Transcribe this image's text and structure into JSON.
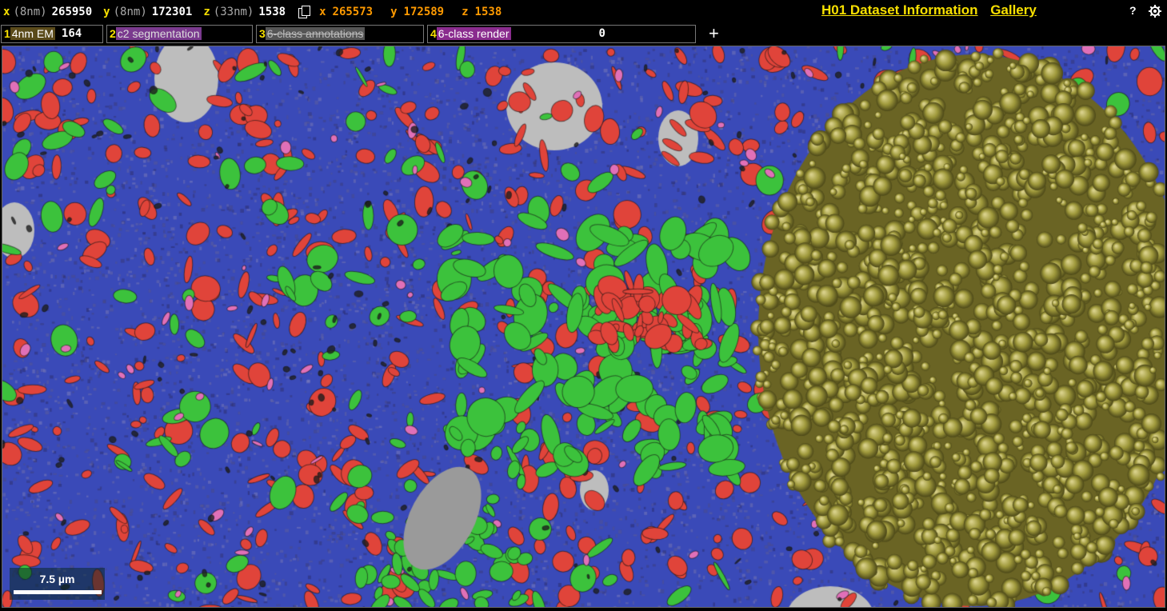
{
  "position": {
    "x": {
      "axis": "x",
      "unit": "(8nm)",
      "value": "265950"
    },
    "y": {
      "axis": "y",
      "unit": "(8nm)",
      "value": "172301"
    },
    "z": {
      "axis": "z",
      "unit": "(33nm)",
      "value": "1538"
    }
  },
  "mouse_position": {
    "x": "265573",
    "y": "172589",
    "z": "1538",
    "x_label": "x",
    "y_label": "y",
    "z_label": "z"
  },
  "header": {
    "info_link": "H01 Dataset Information",
    "gallery_link": "Gallery",
    "help": "?"
  },
  "layers": [
    {
      "num": "1",
      "name": "4nm EM",
      "value": "164"
    },
    {
      "num": "2",
      "name": "c2 segmentation",
      "value": ""
    },
    {
      "num": "3",
      "name": "6-class annotations",
      "value": ""
    },
    {
      "num": "4",
      "name": "6-class render",
      "value": "0"
    }
  ],
  "add_layer": "+",
  "scale_bar": {
    "label": "7.5 µm"
  },
  "colors": {
    "accent_yellow": "#f8e000",
    "mouse_orange": "#ff9a00",
    "class_blue": "#3a4ab8",
    "class_red": "#e0443a",
    "class_green": "#3cc23c",
    "class_pink": "#e070b8",
    "em_gray": "#bdbdbd",
    "mesh_olive": "#a09a3c"
  },
  "icons": {
    "copy": "copy-icon",
    "help": "help-icon",
    "settings": "gear-icon"
  }
}
